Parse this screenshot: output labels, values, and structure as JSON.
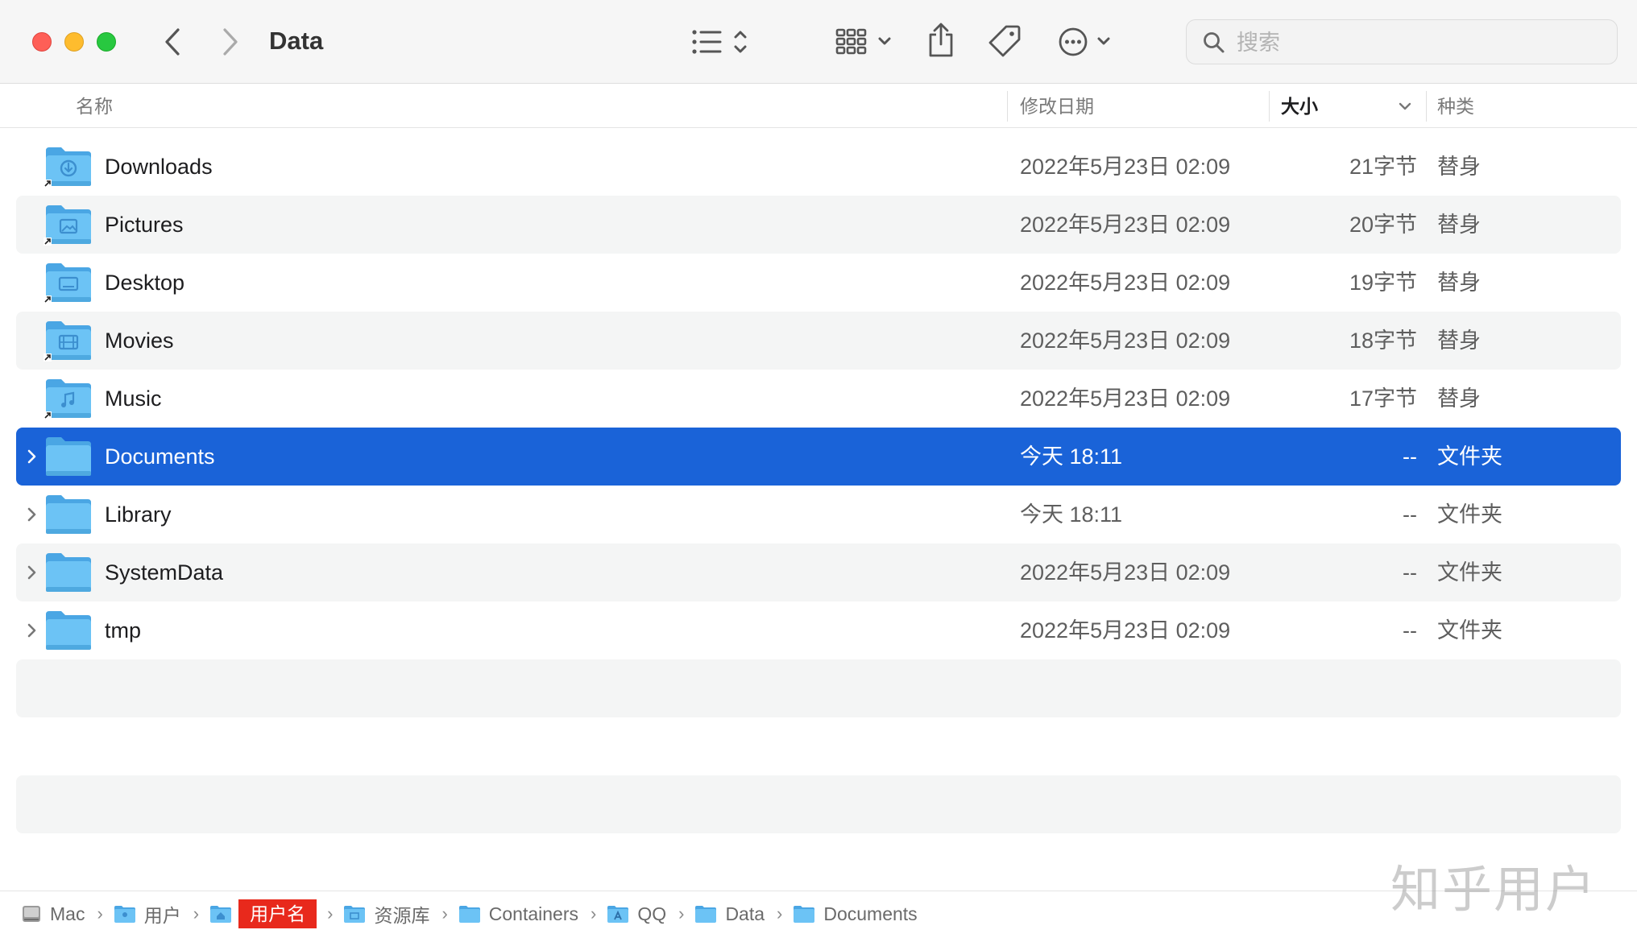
{
  "window": {
    "title": "Data"
  },
  "toolbar": {
    "back_icon": "chevron-left-icon",
    "forward_icon": "chevron-right-icon",
    "view_icon": "list-view-icon",
    "group_icon": "grid-group-icon",
    "share_icon": "share-icon",
    "tag_icon": "tag-icon",
    "more_icon": "ellipsis-circle-icon"
  },
  "search": {
    "placeholder": "搜索"
  },
  "columns": {
    "name": "名称",
    "date": "修改日期",
    "size": "大小",
    "kind": "种类"
  },
  "rows": [
    {
      "name": "Downloads",
      "date": "2022年5月23日 02:09",
      "size": "21字节",
      "kind": "替身",
      "icon": "downloads-folder-icon",
      "alias": true
    },
    {
      "name": "Pictures",
      "date": "2022年5月23日 02:09",
      "size": "20字节",
      "kind": "替身",
      "icon": "pictures-folder-icon",
      "alias": true
    },
    {
      "name": "Desktop",
      "date": "2022年5月23日 02:09",
      "size": "19字节",
      "kind": "替身",
      "icon": "desktop-folder-icon",
      "alias": true
    },
    {
      "name": "Movies",
      "date": "2022年5月23日 02:09",
      "size": "18字节",
      "kind": "替身",
      "icon": "movies-folder-icon",
      "alias": true
    },
    {
      "name": "Music",
      "date": "2022年5月23日 02:09",
      "size": "17字节",
      "kind": "替身",
      "icon": "music-folder-icon",
      "alias": true
    },
    {
      "name": "Documents",
      "date": "今天 18:11",
      "size": "--",
      "kind": "文件夹",
      "icon": "folder-icon",
      "selected": true
    },
    {
      "name": "Library",
      "date": "今天 18:11",
      "size": "--",
      "kind": "文件夹",
      "icon": "folder-icon"
    },
    {
      "name": "SystemData",
      "date": "2022年5月23日 02:09",
      "size": "--",
      "kind": "文件夹",
      "icon": "folder-icon"
    },
    {
      "name": "tmp",
      "date": "2022年5月23日 02:09",
      "size": "--",
      "kind": "文件夹",
      "icon": "folder-icon"
    }
  ],
  "pathbar": [
    {
      "label": "Mac",
      "icon": "disk-icon"
    },
    {
      "label": "用户",
      "icon": "users-folder-icon"
    },
    {
      "label": "用户名",
      "icon": "home-folder-icon",
      "highlighted": true
    },
    {
      "label": "资源库",
      "icon": "library-folder-icon"
    },
    {
      "label": "Containers",
      "icon": "folder-icon"
    },
    {
      "label": "QQ",
      "icon": "app-folder-icon"
    },
    {
      "label": "Data",
      "icon": "folder-icon"
    },
    {
      "label": "Documents",
      "icon": "folder-icon"
    }
  ],
  "watermark": "知乎用户",
  "colors": {
    "selection": "#1a63d8",
    "folder": "#5ab8f0",
    "close": "#fe5f57",
    "minimize": "#febc2e",
    "zoom": "#28c840"
  }
}
